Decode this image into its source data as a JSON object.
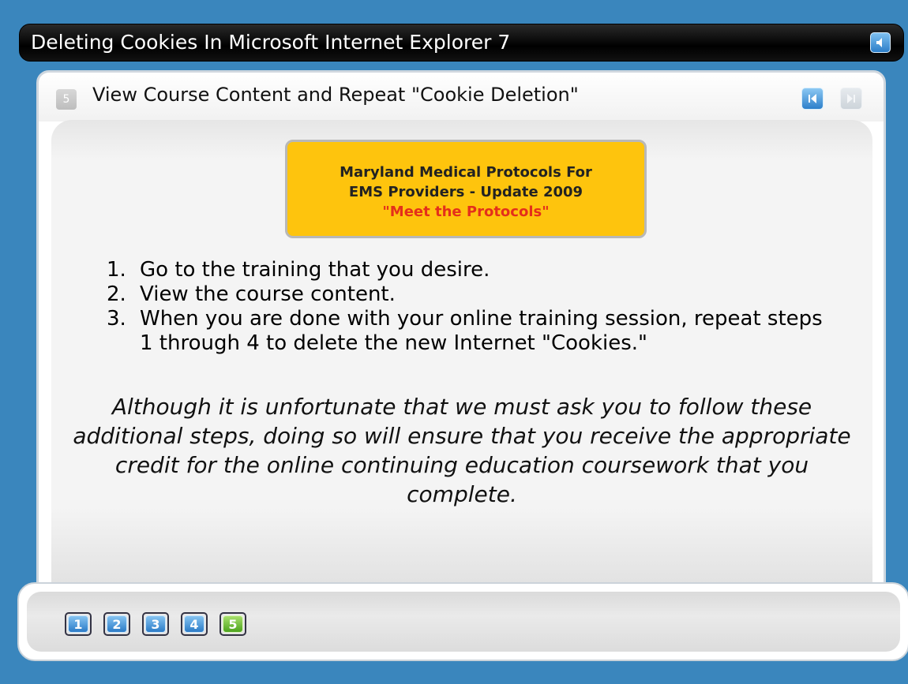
{
  "window": {
    "title": "Deleting Cookies In Microsoft Internet Explorer 7"
  },
  "slide": {
    "step_number": "5",
    "title": "View Course Content and Repeat \"Cookie Deletion\""
  },
  "promo": {
    "line1": "Maryland Medical Protocols For",
    "line2": "EMS Providers - Update 2009",
    "line3": "\"Meet the Protocols\"",
    "background": "#fec40d",
    "highlight_color": "#e42f1b"
  },
  "steps": [
    {
      "num": "1.",
      "text": "Go to the training that you desire."
    },
    {
      "num": "2.",
      "text": "View the course content."
    },
    {
      "num": "3.",
      "text": "When you are done with your online training session, repeat steps 1 through 4 to delete the new Internet \"Cookies.\""
    }
  ],
  "note": "Although it is unfortunate that we must ask you to follow these additional steps, doing so will ensure that you receive the appropriate credit for the online continuing education coursework that you complete.",
  "pagination": {
    "pages": [
      "1",
      "2",
      "3",
      "4",
      "5"
    ],
    "active": "5"
  },
  "icons": {
    "sound": "speaker-icon",
    "prev": "prev-arrow-icon",
    "next": "next-arrow-icon"
  },
  "colors": {
    "background": "#3a86bd",
    "accent_blue": "#2b7bc7",
    "accent_green": "#4da31d"
  }
}
